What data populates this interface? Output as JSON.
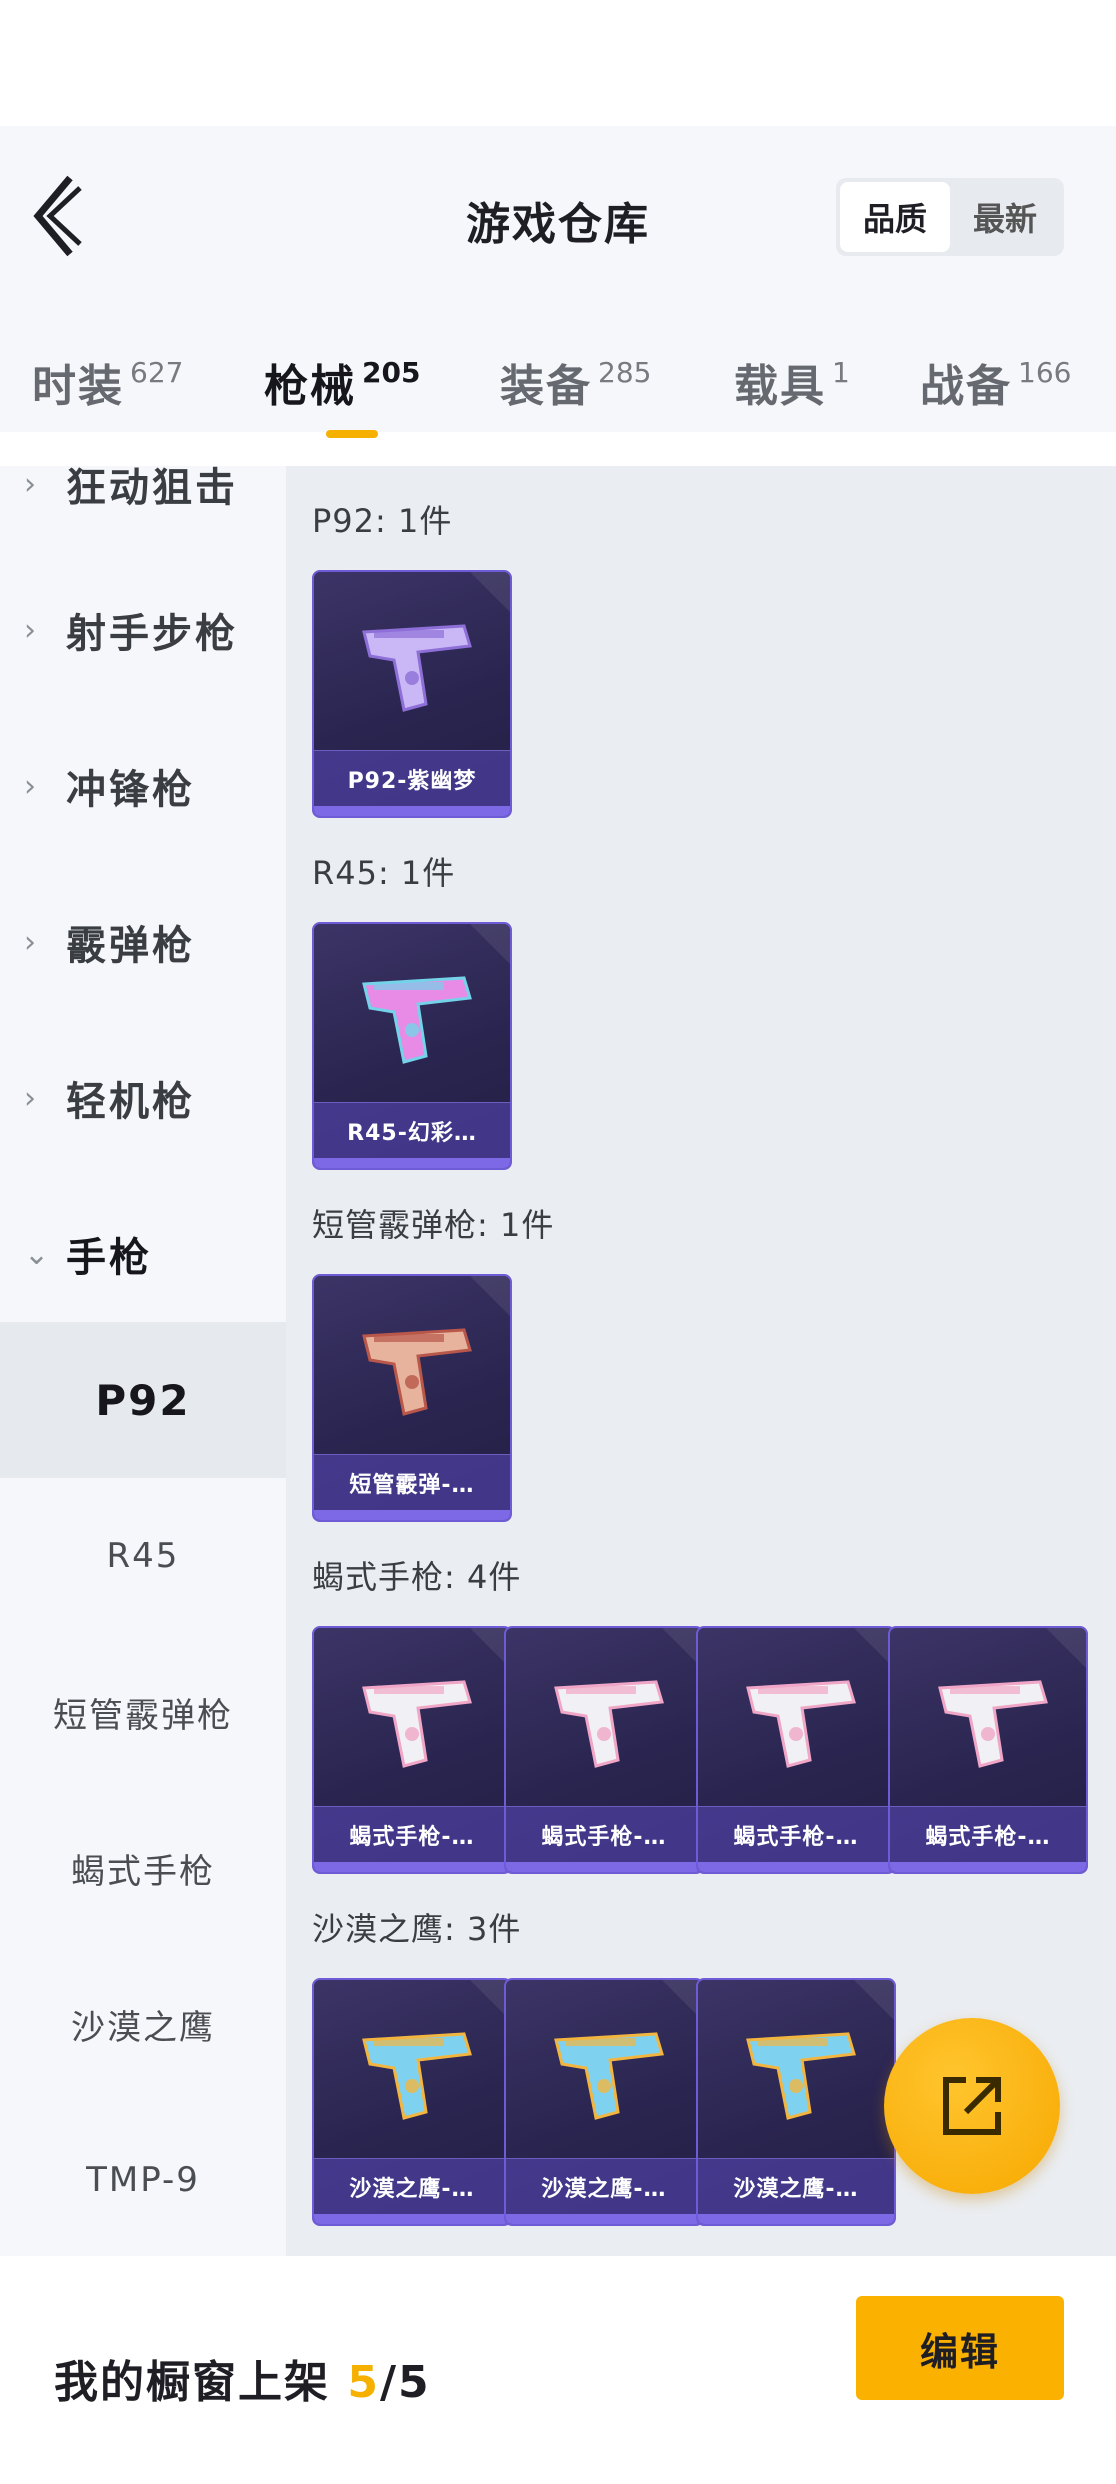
{
  "header": {
    "title": "游戏仓库",
    "sort_options": [
      "品质",
      "最新"
    ]
  },
  "tabs": [
    {
      "label": "时装",
      "count": "627"
    },
    {
      "label": "枪械",
      "count": "205"
    },
    {
      "label": "装备",
      "count": "285"
    },
    {
      "label": "载具",
      "count": "1"
    },
    {
      "label": "战备",
      "count": "166"
    }
  ],
  "sidebar": {
    "partial_category": "狂动狙击",
    "categories": [
      "射手步枪",
      "冲锋枪",
      "霰弹枪",
      "轻机枪"
    ],
    "open_category": "手枪",
    "subitems": [
      "P92",
      "R45",
      "短管霰弹枪",
      "蝎式手枪",
      "沙漠之鹰",
      "TMP-9"
    ]
  },
  "groups": [
    {
      "title": "P92: 1件",
      "items": [
        "P92-紫幽梦"
      ]
    },
    {
      "title": "R45: 1件",
      "items": [
        "R45-幻彩…"
      ]
    },
    {
      "title": "短管霰弹枪: 1件",
      "items": [
        "短管霰弹-…"
      ]
    },
    {
      "title": "蝎式手枪: 4件",
      "items": [
        "蝎式手枪-…",
        "蝎式手枪-…",
        "蝎式手枪-…",
        "蝎式手枪-…"
      ]
    },
    {
      "title": "沙漠之鹰: 3件",
      "items": [
        "沙漠之鹰-…",
        "沙漠之鹰-…",
        "沙漠之鹰-…"
      ]
    }
  ],
  "bottom": {
    "showcase_label": "我的橱窗上架",
    "showcase_current": "5",
    "showcase_total": "/5",
    "edit_label": "编辑"
  },
  "colors": {
    "accent": "#f6b100",
    "card_border": "#6e5bd6"
  },
  "icons": {
    "back": "chevron-left-icon",
    "fab": "share-export-icon",
    "category": "chevron-right-icon"
  }
}
